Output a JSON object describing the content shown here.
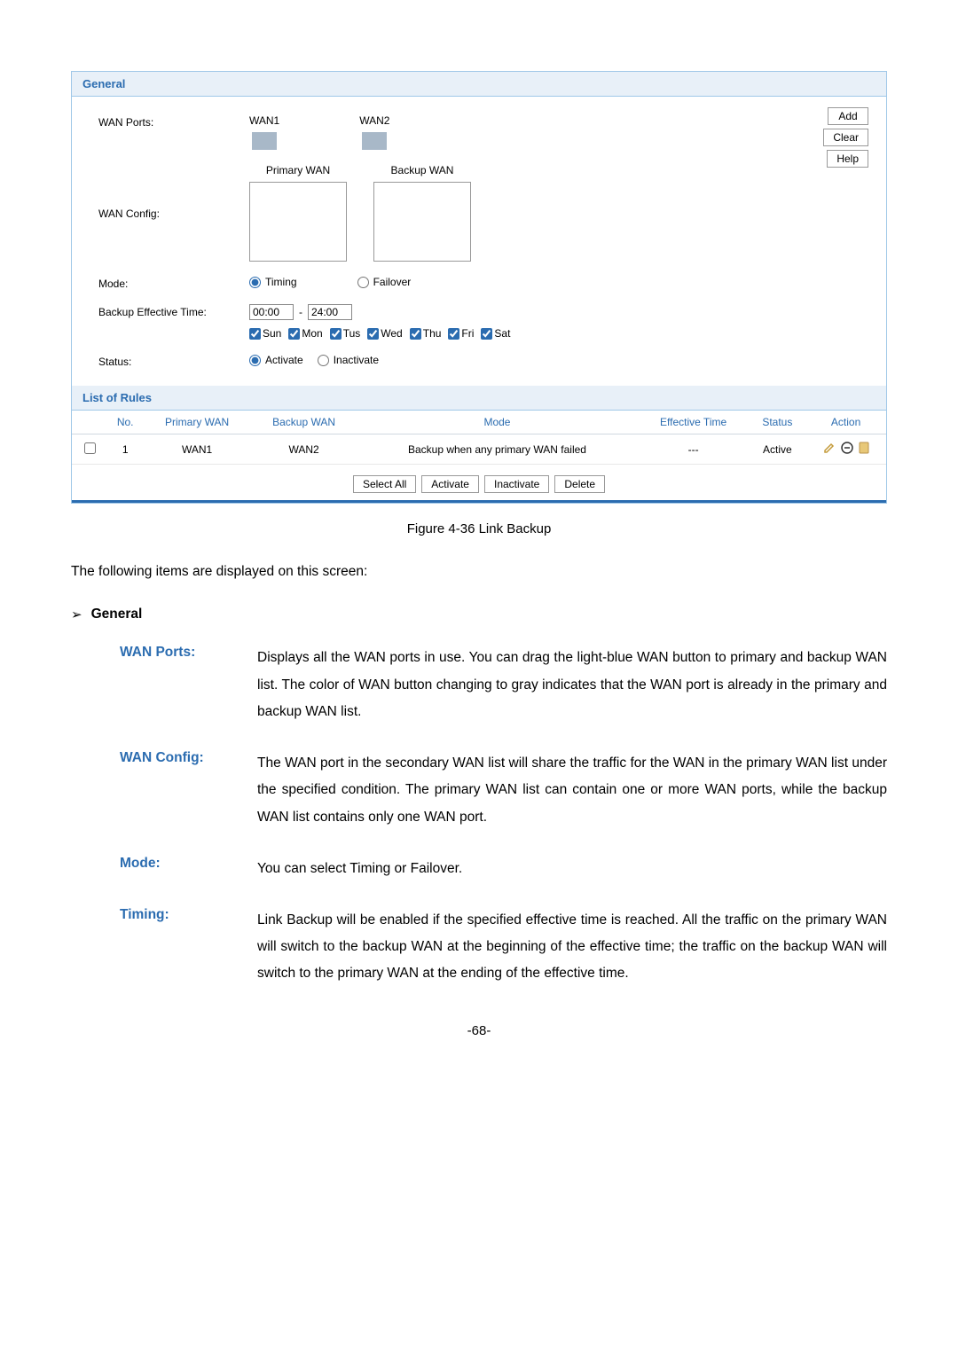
{
  "panel": {
    "general_title": "General",
    "labels": {
      "wan_ports": "WAN Ports:",
      "wan_config": "WAN Config:",
      "mode": "Mode:",
      "backup_time": "Backup Effective Time:",
      "status": "Status:"
    },
    "wan_ports": [
      "WAN1",
      "WAN2"
    ],
    "wan_config_cols": {
      "primary": "Primary WAN",
      "backup": "Backup WAN"
    },
    "mode_options": {
      "timing": "Timing",
      "failover": "Failover"
    },
    "time": {
      "from": "00:00",
      "to": "24:00",
      "sep": "-"
    },
    "days": [
      "Sun",
      "Mon",
      "Tus",
      "Wed",
      "Thu",
      "Fri",
      "Sat"
    ],
    "status_options": {
      "activate": "Activate",
      "inactivate": "Inactivate"
    },
    "buttons": {
      "add": "Add",
      "clear": "Clear",
      "help": "Help"
    },
    "list_title": "List of Rules",
    "columns": [
      "No.",
      "Primary WAN",
      "Backup WAN",
      "Mode",
      "Effective Time",
      "Status",
      "Action"
    ],
    "rows": [
      {
        "no": "1",
        "primary": "WAN1",
        "backup": "WAN2",
        "mode": "Backup when any primary WAN failed",
        "effective": "---",
        "status": "Active"
      }
    ],
    "bottom_buttons": {
      "select_all": "Select All",
      "activate": "Activate",
      "inactivate": "Inactivate",
      "delete": "Delete"
    }
  },
  "doc": {
    "figure_caption": "Figure 4-36 Link Backup",
    "intro": "The following items are displayed on this screen:",
    "section_title": "General",
    "definitions": [
      {
        "term": "WAN Ports:",
        "desc": "Displays all the WAN ports in use. You can drag the light-blue WAN button to primary and backup WAN list. The color of WAN button changing to gray indicates that the WAN port is already in the primary and backup WAN list."
      },
      {
        "term": "WAN Config:",
        "desc": "The WAN port in the secondary WAN list will share the traffic for the WAN in the primary WAN list under the specified condition. The primary WAN list can contain one or more WAN ports, while the backup WAN list contains only one WAN port."
      },
      {
        "term": "Mode:",
        "desc": "You can select Timing or Failover."
      },
      {
        "term": "Timing:",
        "desc": "Link Backup will be enabled if the specified effective time is reached. All the traffic on the primary WAN will switch to the backup WAN at the beginning of the effective time; the traffic on the backup WAN will switch to the primary WAN at the ending of the effective time."
      }
    ],
    "page_number": "-68-"
  }
}
